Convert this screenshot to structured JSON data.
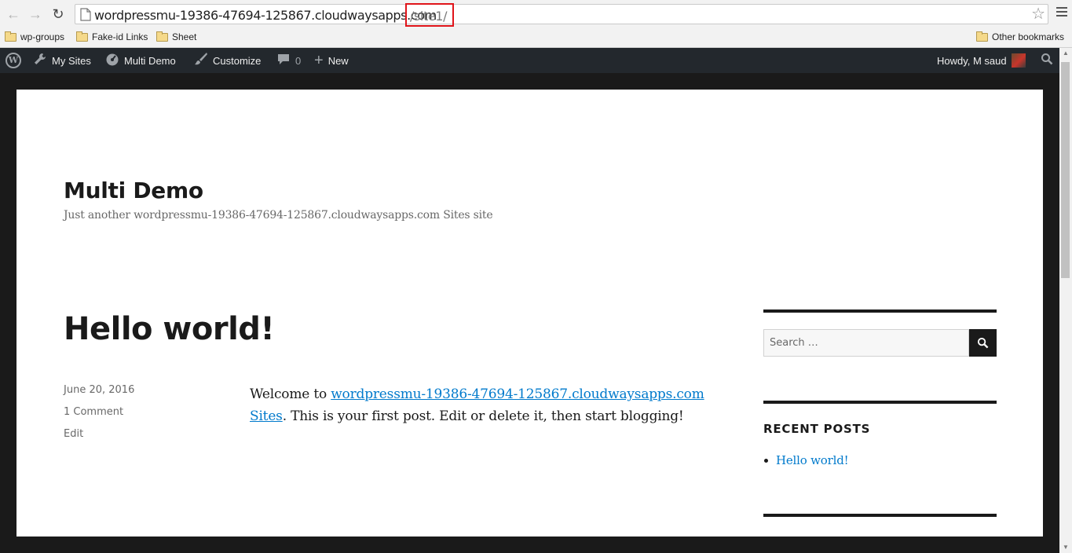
{
  "browser": {
    "url_host": "wordpressmu-19386-47694-125867.cloudwaysapps.com",
    "url_path": "/site1/",
    "icons": [
      "back-arrow-icon",
      "forward-arrow-icon",
      "reload-icon",
      "star-icon",
      "menu-icon"
    ],
    "bookmarks": [
      {
        "label": "wp-groups"
      },
      {
        "label": "Fake-id Links"
      },
      {
        "label": "Sheet"
      }
    ],
    "other_bookmarks": "Other bookmarks"
  },
  "adminbar": {
    "my_sites": "My Sites",
    "site_name": "Multi Demo",
    "customize": "Customize",
    "comments_count": "0",
    "new": "New",
    "howdy": "Howdy, M saud"
  },
  "site": {
    "title": "Multi Demo",
    "description": "Just another wordpressmu-19386-47694-125867.cloudwaysapps.com Sites site"
  },
  "post": {
    "title": "Hello world!",
    "date": "June 20, 2016",
    "comments": "1 Comment",
    "edit": "Edit",
    "body_prefix": "Welcome to ",
    "body_link": "wordpressmu-19386-47694-125867.cloudwaysapps.com Sites",
    "body_suffix": ". This is your first post. Edit or delete it, then start blogging!"
  },
  "sidebar": {
    "search_placeholder": "Search …",
    "recent_posts_title": "RECENT POSTS",
    "recent_posts": [
      "Hello world!"
    ]
  },
  "colors": {
    "adminbar_bg": "#23282d",
    "link": "#007acc",
    "highlight_border": "#e0141a",
    "page_frame": "#1a1a1a"
  }
}
